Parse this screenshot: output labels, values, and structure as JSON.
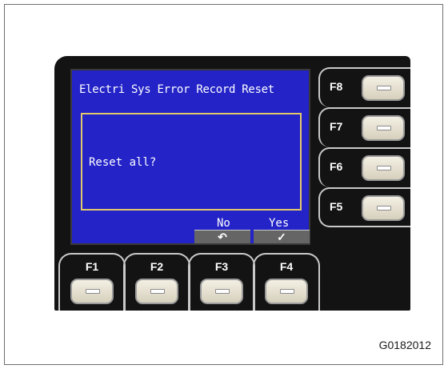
{
  "screen": {
    "title": "Electri Sys Error Record Reset",
    "message": "Reset all?",
    "soft_keys": [
      {
        "label": "No",
        "icon": "undo-arrow-icon",
        "glyph": "↶"
      },
      {
        "label": "Yes",
        "icon": "check-icon",
        "glyph": "✓"
      }
    ]
  },
  "side_keys": [
    {
      "label": "F8"
    },
    {
      "label": "F7"
    },
    {
      "label": "F6"
    },
    {
      "label": "F5"
    }
  ],
  "bottom_keys": [
    {
      "label": "F1"
    },
    {
      "label": "F2"
    },
    {
      "label": "F3"
    },
    {
      "label": "F4"
    }
  ],
  "figure_code": "G0182012",
  "colors": {
    "screen_background": "#2323c8",
    "dialog_border": "#e3c96a",
    "panel": "#131313",
    "key_face": "#f3efe3"
  }
}
